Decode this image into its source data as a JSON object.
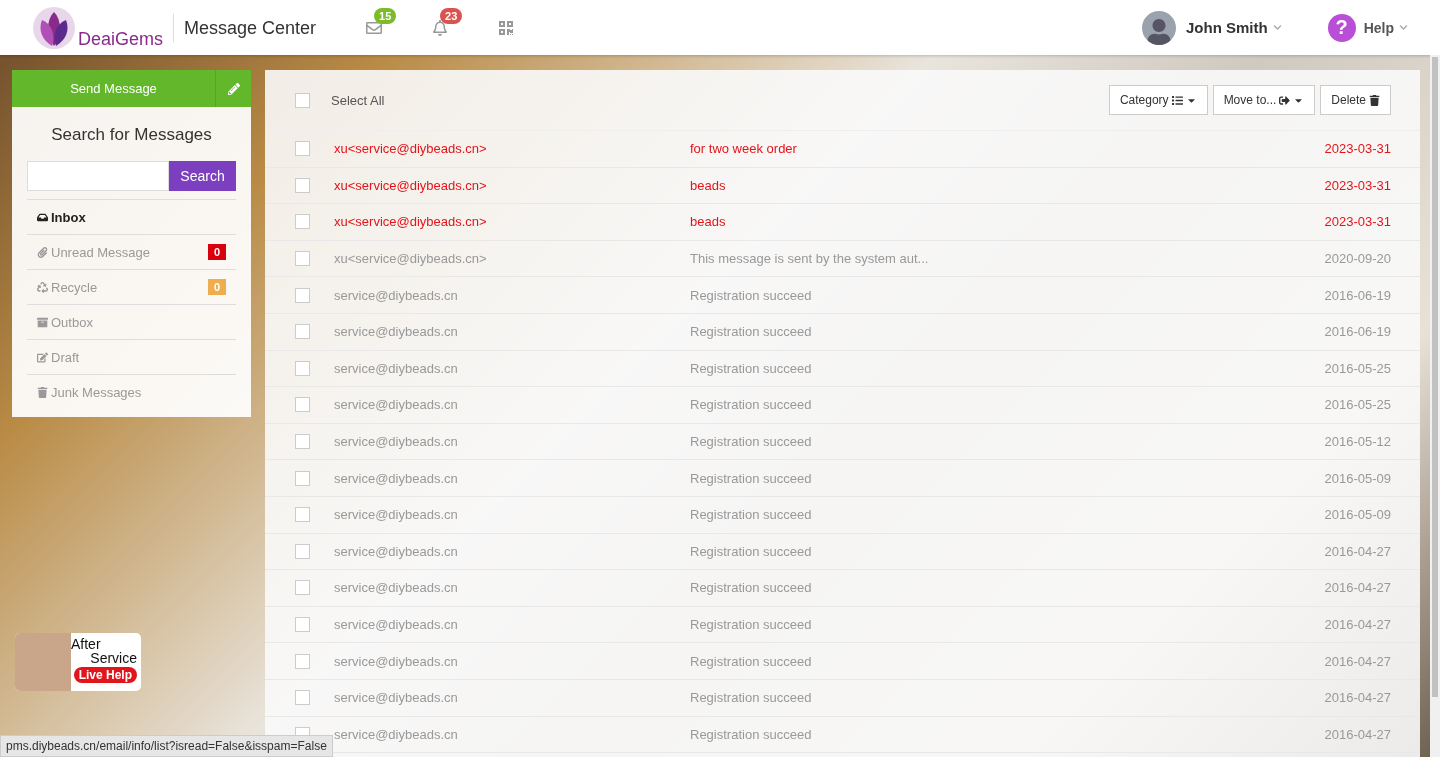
{
  "header": {
    "logo": "DeaiGems",
    "title": "Message Center",
    "mail_count": "15",
    "notice_count": "23",
    "user": "John Smith",
    "help_icon": "?",
    "help": "Help"
  },
  "sidebar": {
    "send_button": "Send Message",
    "search_title": "Search for Messages",
    "search_button": "Search",
    "items": [
      {
        "label": "Inbox",
        "selected": true
      },
      {
        "label": "Unread Message",
        "selected": false,
        "badge": "0",
        "color": "#d9000d"
      },
      {
        "label": "Recycle",
        "selected": false,
        "badge": "0",
        "color": "#f0ad4e"
      },
      {
        "label": "Outbox",
        "selected": false
      },
      {
        "label": "Draft",
        "selected": false
      },
      {
        "label": "Junk Messages",
        "selected": false
      }
    ]
  },
  "live_help": {
    "line1": "After",
    "line2": "Service",
    "button": "Live Help"
  },
  "toolbar": {
    "select_all": "Select All",
    "select_all_checked": false,
    "buttons": [
      {
        "label": "Category"
      },
      {
        "label": "Move to..."
      },
      {
        "label": "Delete"
      }
    ]
  },
  "messages": [
    {
      "from": "xu<service@diybeads.cn>",
      "subject": "for two week order",
      "date": "2023-03-31",
      "unread": true,
      "checked": false
    },
    {
      "from": "xu<service@diybeads.cn>",
      "subject": "beads",
      "date": "2023-03-31",
      "unread": true,
      "checked": false
    },
    {
      "from": "xu<service@diybeads.cn>",
      "subject": "beads",
      "date": "2023-03-31",
      "unread": true,
      "checked": false
    },
    {
      "from": "xu<service@diybeads.cn>",
      "subject": "This message is sent by the system aut...",
      "date": "2020-09-20",
      "unread": false,
      "checked": false
    },
    {
      "from": "service@diybeads.cn",
      "subject": "Registration succeed",
      "date": "2016-06-19",
      "unread": false,
      "checked": false
    },
    {
      "from": "service@diybeads.cn",
      "subject": "Registration succeed",
      "date": "2016-06-19",
      "unread": false,
      "checked": false
    },
    {
      "from": "service@diybeads.cn",
      "subject": "Registration succeed",
      "date": "2016-05-25",
      "unread": false,
      "checked": false
    },
    {
      "from": "service@diybeads.cn",
      "subject": "Registration succeed",
      "date": "2016-05-25",
      "unread": false,
      "checked": false
    },
    {
      "from": "service@diybeads.cn",
      "subject": "Registration succeed",
      "date": "2016-05-12",
      "unread": false,
      "checked": false
    },
    {
      "from": "service@diybeads.cn",
      "subject": "Registration succeed",
      "date": "2016-05-09",
      "unread": false,
      "checked": false
    },
    {
      "from": "service@diybeads.cn",
      "subject": "Registration succeed",
      "date": "2016-05-09",
      "unread": false,
      "checked": false
    },
    {
      "from": "service@diybeads.cn",
      "subject": "Registration succeed",
      "date": "2016-04-27",
      "unread": false,
      "checked": false
    },
    {
      "from": "service@diybeads.cn",
      "subject": "Registration succeed",
      "date": "2016-04-27",
      "unread": false,
      "checked": false
    },
    {
      "from": "service@diybeads.cn",
      "subject": "Registration succeed",
      "date": "2016-04-27",
      "unread": false,
      "checked": false
    },
    {
      "from": "service@diybeads.cn",
      "subject": "Registration succeed",
      "date": "2016-04-27",
      "unread": false,
      "checked": false
    },
    {
      "from": "service@diybeads.cn",
      "subject": "Registration succeed",
      "date": "2016-04-27",
      "unread": false,
      "checked": false
    },
    {
      "from": "service@diybeads.cn",
      "subject": "Registration succeed",
      "date": "2016-04-27",
      "unread": false,
      "checked": false
    }
  ],
  "status_bar": "pms.diybeads.cn/email/info/list?isread=False&isspam=False"
}
